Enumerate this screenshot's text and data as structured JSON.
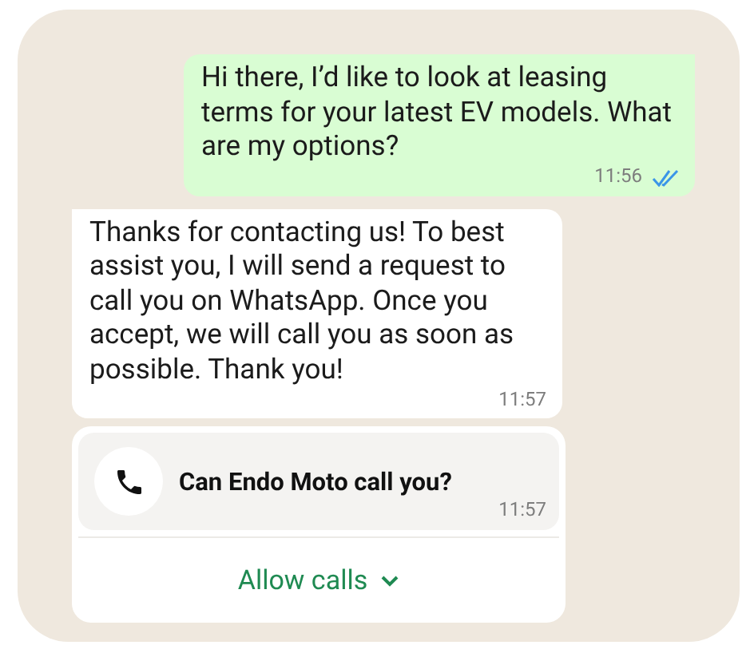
{
  "messages": [
    {
      "kind": "outgoing",
      "text": "Hi there, I’d like to look at leasing terms for your latest EV models. What are my options?",
      "time": "11:56",
      "read": true
    },
    {
      "kind": "incoming",
      "text": "Thanks for contacting us! To best assist you, I will send a request to call you on WhatsApp. Once you accept, we will call you as soon as possible. Thank you!",
      "time": "11:57"
    },
    {
      "kind": "call_request",
      "text": "Can Endo Moto call you?",
      "time": "11:57",
      "action": "Allow calls"
    }
  ]
}
